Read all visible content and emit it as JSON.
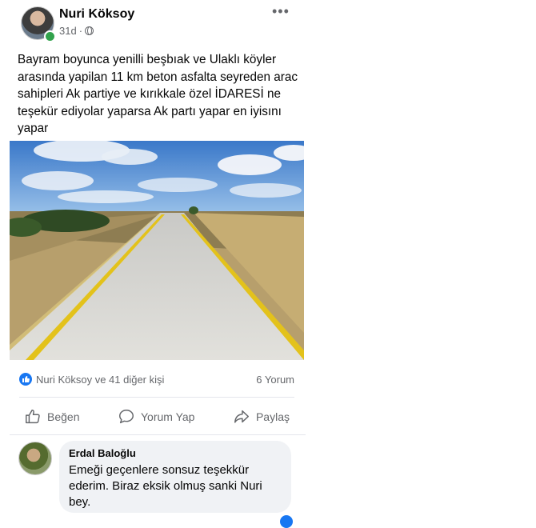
{
  "post": {
    "author": "Nuri Köksoy",
    "time": "31d",
    "separator": "·",
    "more": "•••",
    "text": "Bayram boyunca yenilli beşbıak ve Ulaklı köyler arasında yapilan 11 km beton asfalta seyreden arac sahipleri Ak partiye ve kırıkkale özel İDARESİ ne  teşekür ediyolar yaparsa Ak partı yapar en iyisını yapar",
    "reactions": "Nuri Köksoy ve 41 diğer kişi",
    "comment_count": "6 Yorum"
  },
  "actions": {
    "like": "Beğen",
    "comment": "Yorum Yap",
    "share": "Paylaş"
  },
  "comment": {
    "author": "Erdal Baloğlu",
    "text": "Emeği geçenlere sonsuz teşekkür ederim. Biraz eksik olmuş sanki Nuri bey."
  },
  "colors": {
    "accent": "#1877f2",
    "secondary_text": "#65676b",
    "online": "#31a24c",
    "bubble": "#f0f2f5"
  }
}
